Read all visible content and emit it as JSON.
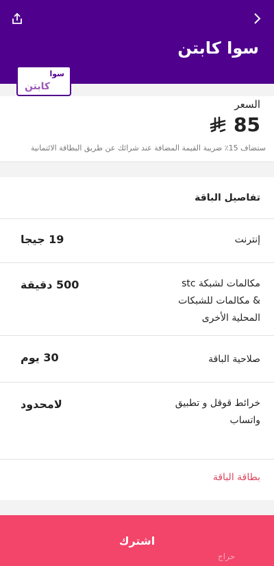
{
  "header": {
    "title": "سوا كابتن",
    "bg_color": "#4f008c"
  },
  "logo": {
    "line1": "سوا",
    "line2": "كابتن"
  },
  "price": {
    "label": "السعر",
    "value": "85",
    "currency_icon": "riyal-icon",
    "vat_note": "ستضاف 15٪ ضريبة القيمة المضافة عند شرائك عن طريق البطاقة الائتمانية"
  },
  "details": {
    "title": "تفاصيل الباقة",
    "rows": [
      {
        "label": "إنترنت",
        "value": "19 جيجا"
      },
      {
        "label": "مكالمات لشبكة stc\n& مكالمات للشبكات\nالمحلية الأخرى",
        "value": "500 دقيقة"
      },
      {
        "label": "صلاحية الباقة",
        "value": "30 يوم"
      },
      {
        "label": "خرائط قوقل و تطبيق\nواتساب",
        "value": "لامحدود"
      }
    ],
    "link": "بطاقة الباقة"
  },
  "cta": {
    "label": "اشترك",
    "color": "#f3446a"
  },
  "watermark": "حراج"
}
